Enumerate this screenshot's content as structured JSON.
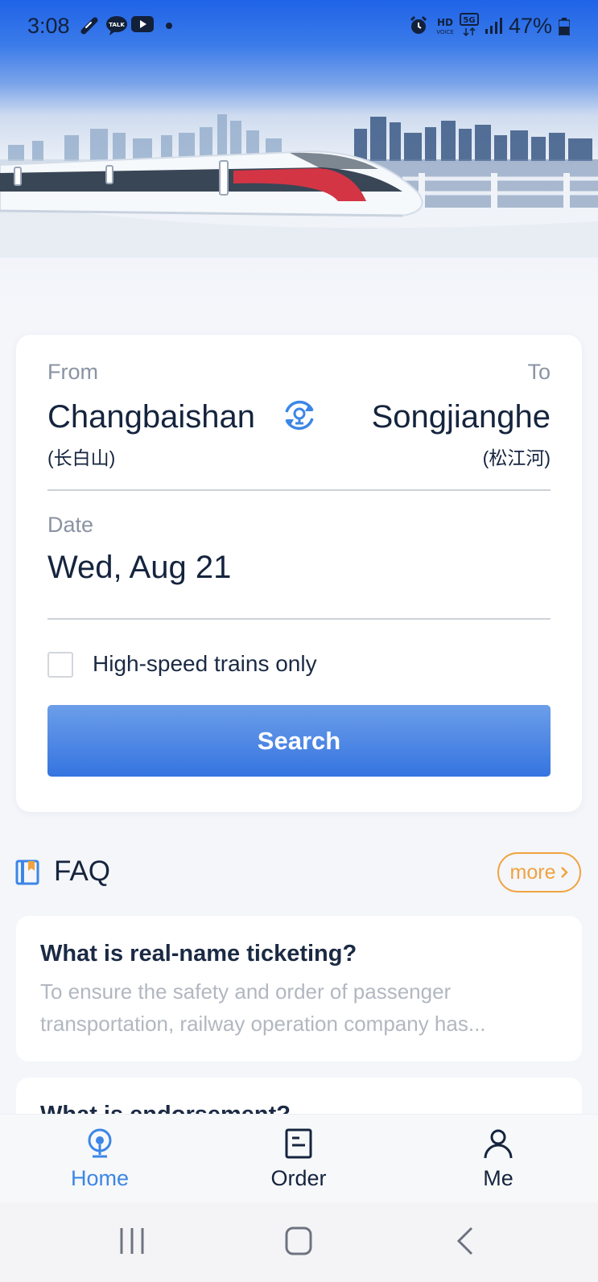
{
  "status_bar": {
    "time": "3:08",
    "battery": "47%",
    "icons": [
      "link-icon",
      "talk-icon",
      "youtube-icon",
      "dot-icon",
      "alarm-icon",
      "hd-voice-icon",
      "5g-icon",
      "signal-icon",
      "battery-icon"
    ],
    "badges": {
      "talk": "TALK",
      "hd": "HD",
      "voice": "VOICE",
      "five_g": "5G"
    }
  },
  "booking": {
    "from_label": "From",
    "to_label": "To",
    "from_station": "Changbaishan",
    "from_station_cn": "(长白山)",
    "to_station": "Songjianghe",
    "to_station_cn": "(松江河)",
    "date_label": "Date",
    "date_value": "Wed, Aug 21",
    "highspeed_label": "High-speed trains only",
    "highspeed_checked": false,
    "search_label": "Search"
  },
  "faq": {
    "title": "FAQ",
    "more_label": "more",
    "items": [
      {
        "question": "What is real-name ticketing?",
        "answer_line1": "To ensure the safety and order of passenger",
        "answer_line2": "transportation, railway operation company has..."
      },
      {
        "question": "What is endorsement?"
      }
    ]
  },
  "bottom_nav": {
    "items": [
      {
        "label": "Home",
        "icon": "train-icon",
        "active": true
      },
      {
        "label": "Order",
        "icon": "order-icon",
        "active": false
      },
      {
        "label": "Me",
        "icon": "user-icon",
        "active": false
      }
    ]
  },
  "colors": {
    "accent": "#3c86e6",
    "primary_button": "#3574e0",
    "more_orange": "#f0a340",
    "text_dark": "#15243e"
  }
}
